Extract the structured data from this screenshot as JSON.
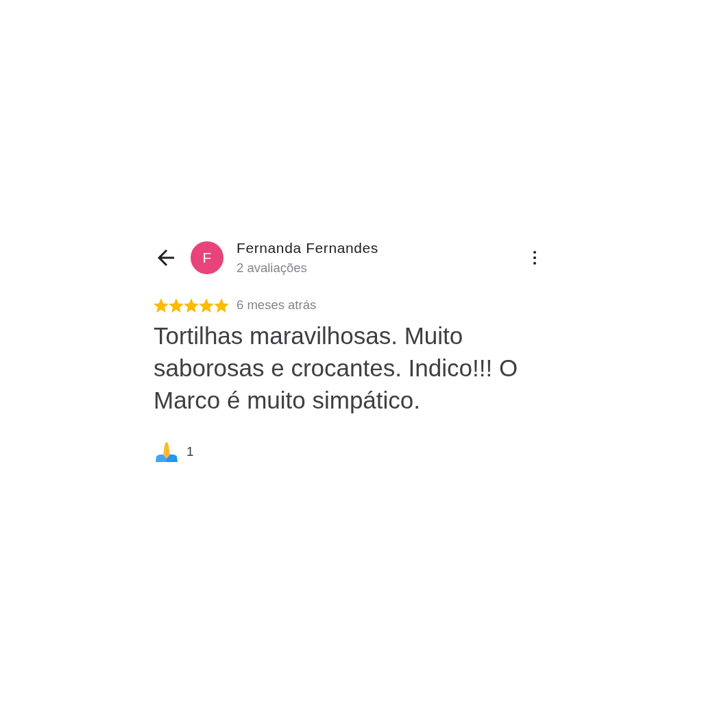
{
  "reviewer": {
    "initial": "F",
    "name": "Fernanda Fernandes",
    "review_count": "2 avaliações"
  },
  "review": {
    "stars": 5,
    "time": "6 meses atrás",
    "text": "Tortilhas maravilhosas. Muito saborosas e crocantes. Indico!!! O Marco é muito simpático.",
    "reactions": [
      {
        "count": "1"
      }
    ]
  }
}
